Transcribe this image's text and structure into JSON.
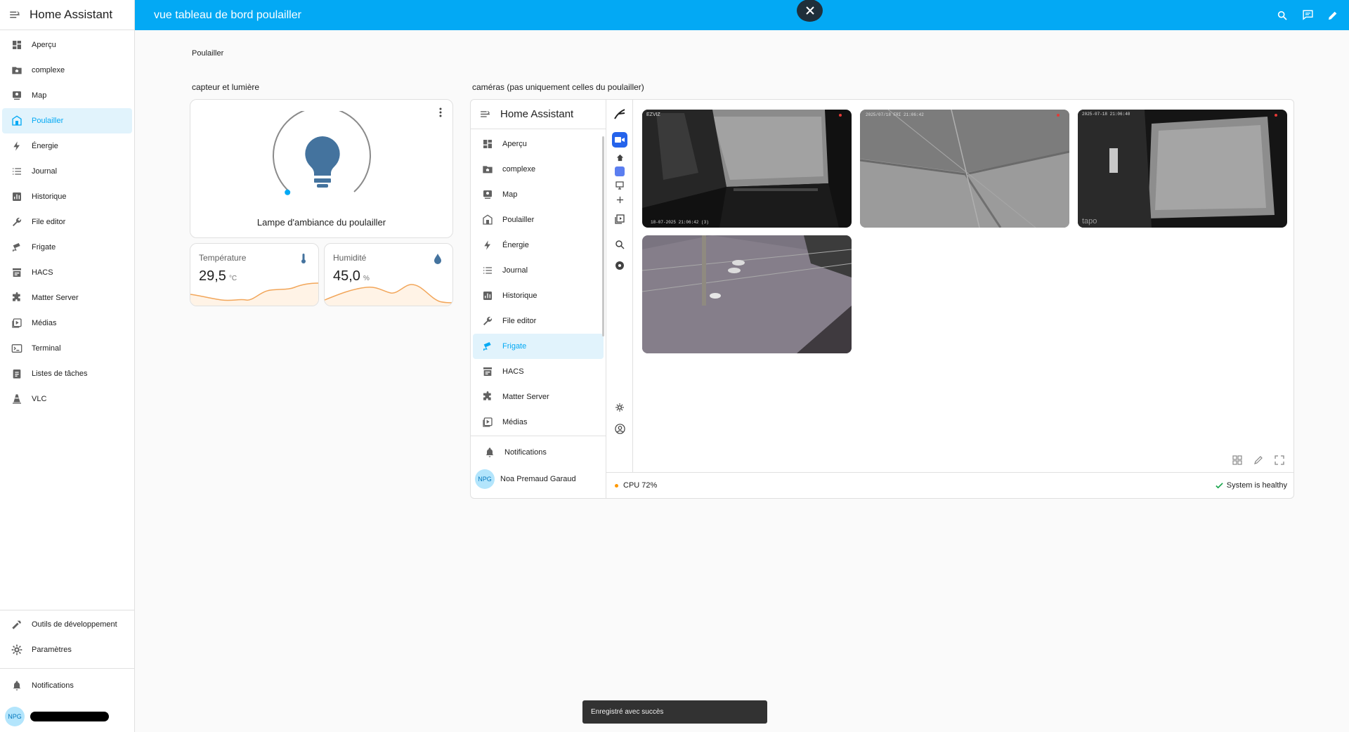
{
  "app": {
    "title": "Home Assistant"
  },
  "sidebar": {
    "items": [
      {
        "label": "Aperçu",
        "icon": "dashboard-icon"
      },
      {
        "label": "complexe",
        "icon": "folder-home-icon"
      },
      {
        "label": "Map",
        "icon": "map-icon"
      },
      {
        "label": "Poulailler",
        "icon": "coop-icon",
        "active": true
      },
      {
        "label": "Énergie",
        "icon": "lightning-icon"
      },
      {
        "label": "Journal",
        "icon": "list-icon"
      },
      {
        "label": "Historique",
        "icon": "chart-icon"
      },
      {
        "label": "File editor",
        "icon": "wrench-icon"
      },
      {
        "label": "Frigate",
        "icon": "cctv-icon"
      },
      {
        "label": "HACS",
        "icon": "store-icon"
      },
      {
        "label": "Matter Server",
        "icon": "puzzle-icon"
      },
      {
        "label": "Médias",
        "icon": "media-icon"
      },
      {
        "label": "Terminal",
        "icon": "terminal-icon"
      },
      {
        "label": "Listes de tâches",
        "icon": "clipboard-list-icon"
      },
      {
        "label": "VLC",
        "icon": "cone-icon"
      }
    ],
    "dev_tools": "Outils de développement",
    "settings": "Paramètres",
    "notifications": "Notifications",
    "user_initials": "NPG"
  },
  "topbar": {
    "title": "vue tableau de bord poulailler"
  },
  "main": {
    "breadcrumb": "Poulailler",
    "section1": "capteur et lumière",
    "section2": "caméras (pas uniquement celles du poulailler)",
    "light": {
      "name": "Lampe d'ambiance du poulailler",
      "level_percent": 0
    },
    "temperature": {
      "name": "Température",
      "value": "29,5",
      "unit": "°C"
    },
    "humidity": {
      "name": "Humidité",
      "value": "45,0",
      "unit": "%"
    }
  },
  "preview": {
    "title": "Home Assistant",
    "items": [
      {
        "label": "Aperçu",
        "icon": "dashboard-icon"
      },
      {
        "label": "complexe",
        "icon": "folder-home-icon"
      },
      {
        "label": "Map",
        "icon": "map-icon"
      },
      {
        "label": "Poulailler",
        "icon": "coop-icon"
      },
      {
        "label": "Énergie",
        "icon": "lightning-icon"
      },
      {
        "label": "Journal",
        "icon": "list-icon"
      },
      {
        "label": "Historique",
        "icon": "chart-icon"
      },
      {
        "label": "File editor",
        "icon": "wrench-icon"
      },
      {
        "label": "Frigate",
        "icon": "cctv-icon",
        "active": true
      },
      {
        "label": "HACS",
        "icon": "store-icon"
      },
      {
        "label": "Matter Server",
        "icon": "puzzle-icon"
      },
      {
        "label": "Médias",
        "icon": "media-icon"
      }
    ],
    "notifications": "Notifications",
    "user_name": "Noa Premaud Garaud",
    "user_initials": "NPG",
    "cpu": "CPU 72%",
    "health": "System is healthy",
    "cameras": [
      {
        "overlay": "EZVIZ",
        "timestamp": "18-07-2025 21:06:42 (3)"
      },
      {
        "overlay": "2025/07/18 FRI 21:06:42",
        "timestamp": ""
      },
      {
        "overlay": "2025-07-18 21:06:40",
        "timestamp": "tapo"
      },
      {
        "overlay": "",
        "timestamp": ""
      }
    ]
  },
  "toast": "Enregistré avec succès"
}
